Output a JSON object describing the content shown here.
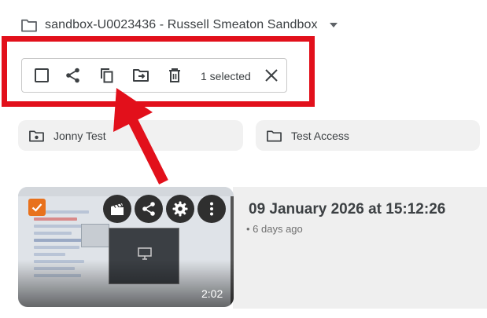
{
  "header": {
    "title": "sandbox-U0023436 - Russell Smeaton Sandbox"
  },
  "toolbar": {
    "selected_count": "1 selected",
    "icons": [
      "select-checkbox-icon",
      "share-icon",
      "copy-icon",
      "move-to-folder-icon",
      "delete-icon",
      "close-icon"
    ]
  },
  "folders": [
    {
      "name": "Jonny Test"
    },
    {
      "name": "Test Access"
    }
  ],
  "video": {
    "title": "09 January 2026 at 15:12:26",
    "age": "• 6 days ago",
    "duration": "2:02"
  },
  "colors": {
    "highlight": "#e2101b",
    "arrow": "#e2101b",
    "checkbox": "#e8711c"
  }
}
